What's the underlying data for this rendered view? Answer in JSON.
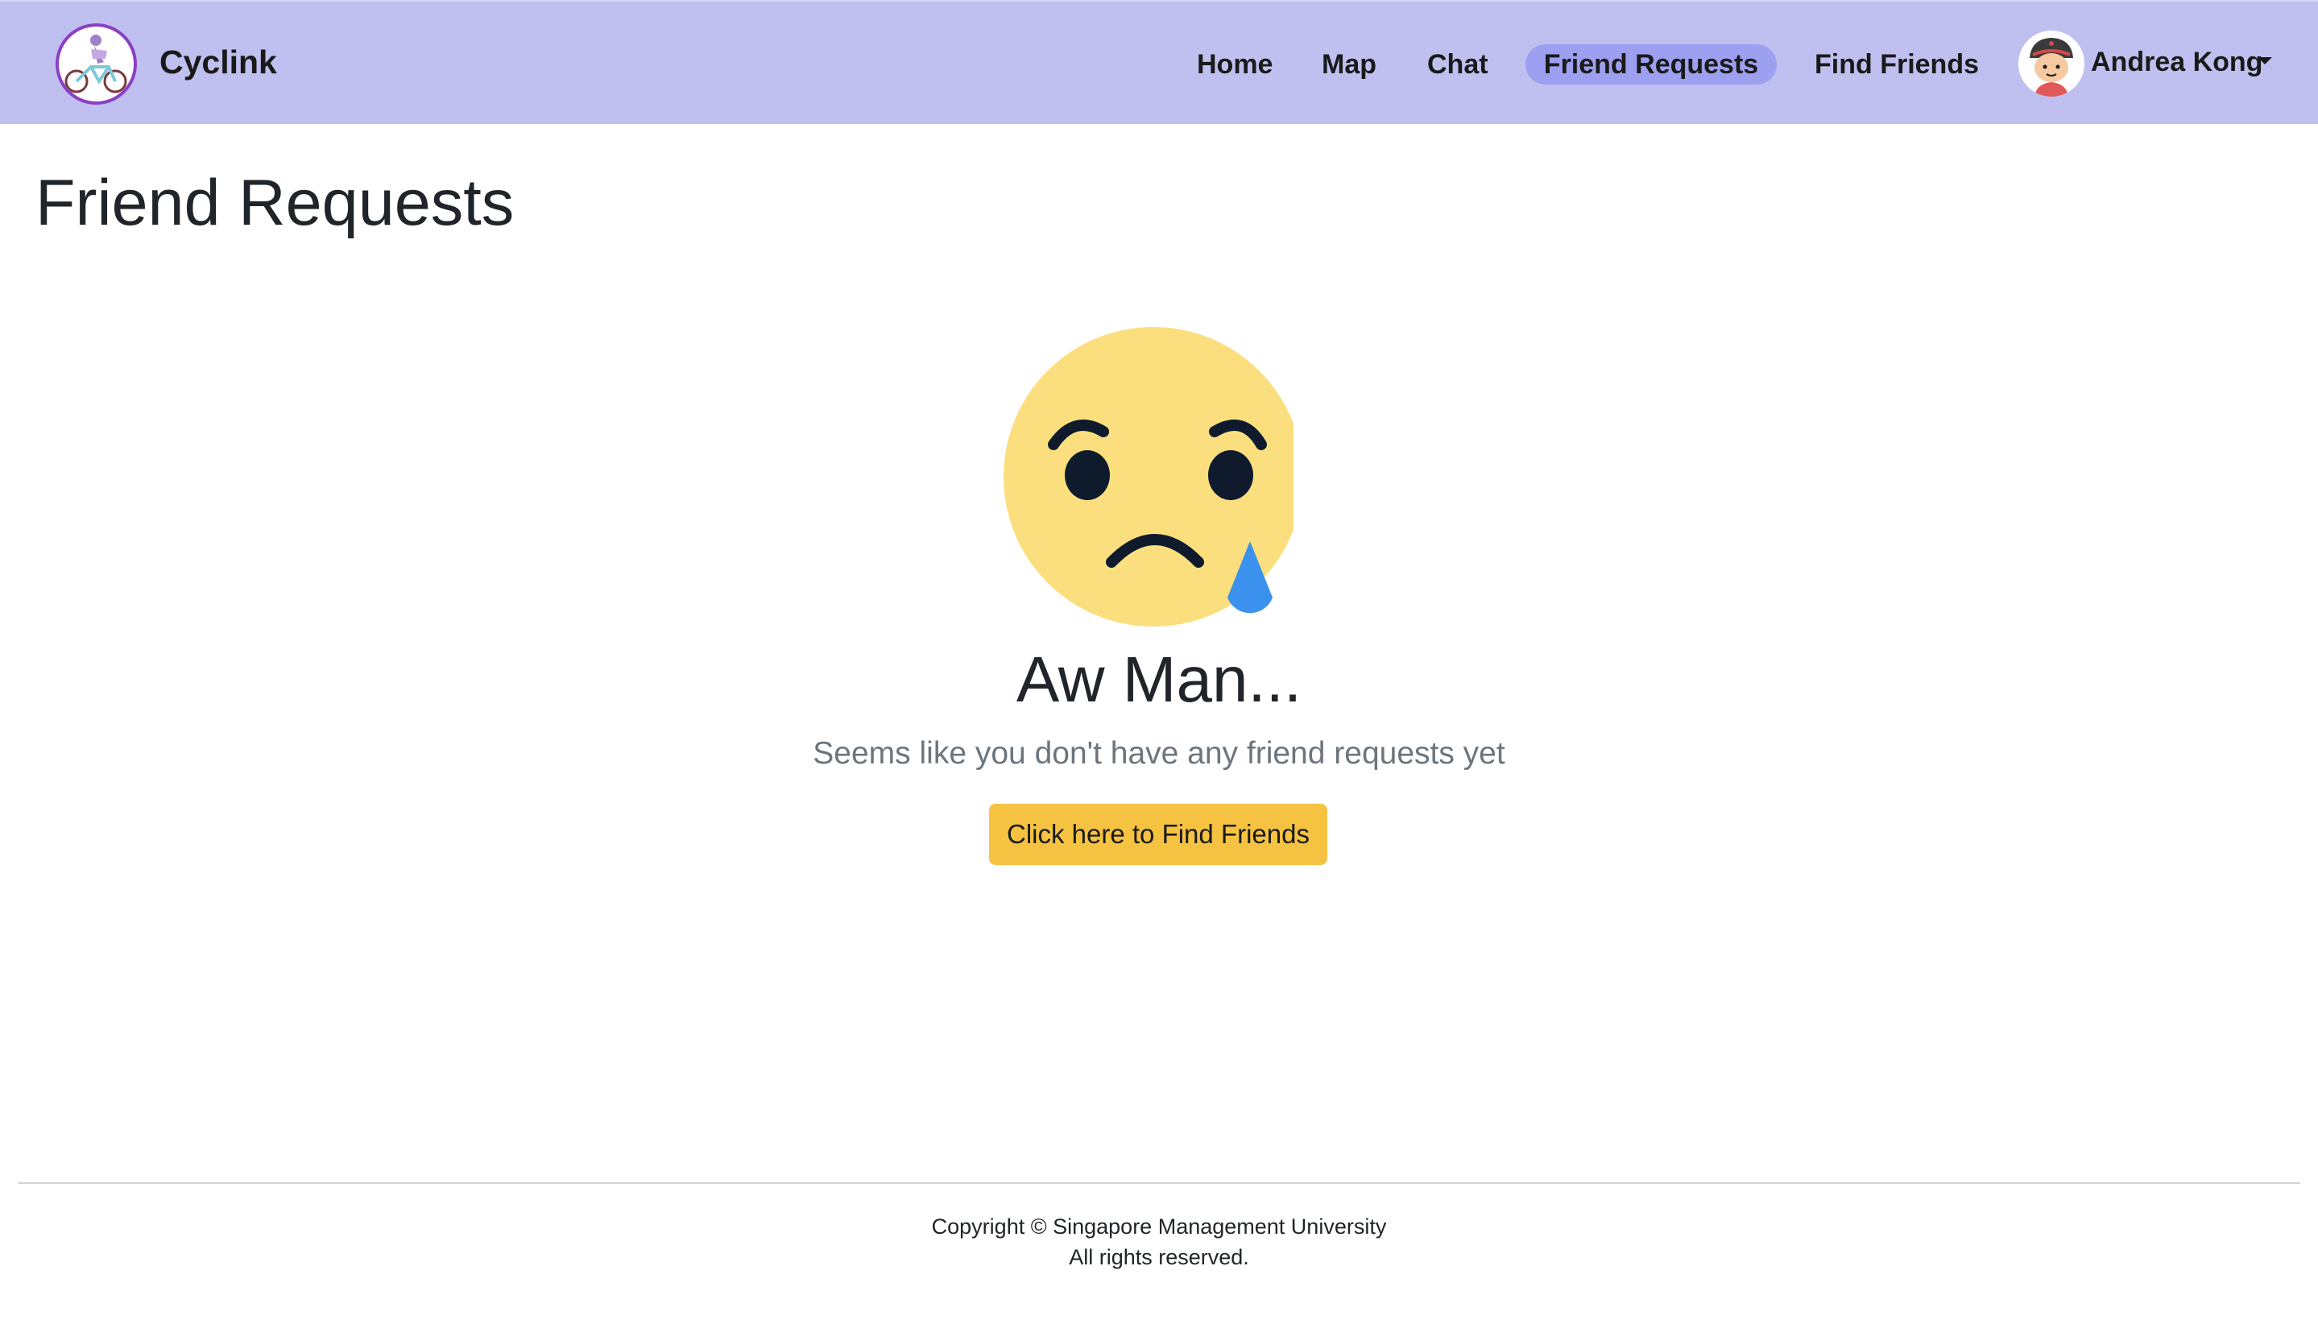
{
  "navbar": {
    "brand_name": "Cyclink",
    "items": [
      {
        "label": "Home"
      },
      {
        "label": "Map"
      },
      {
        "label": "Chat"
      },
      {
        "label": "Friend Requests",
        "active": true
      },
      {
        "label": "Find Friends"
      }
    ],
    "user_name": "Andrea Kong",
    "background_color": "#bfc0f0",
    "active_pill_color": "#9d9ff0"
  },
  "main": {
    "page_title": "Friend Requests",
    "emoji_icon": "crying-face-icon",
    "heading": "Aw Man...",
    "subtext": "Seems like you don't have any friend requests yet",
    "button_label": "Click here to Find Friends",
    "button_color": "#f6c242"
  },
  "footer": {
    "line1": "Copyright © Singapore Management University",
    "line2": "All rights reserved."
  }
}
